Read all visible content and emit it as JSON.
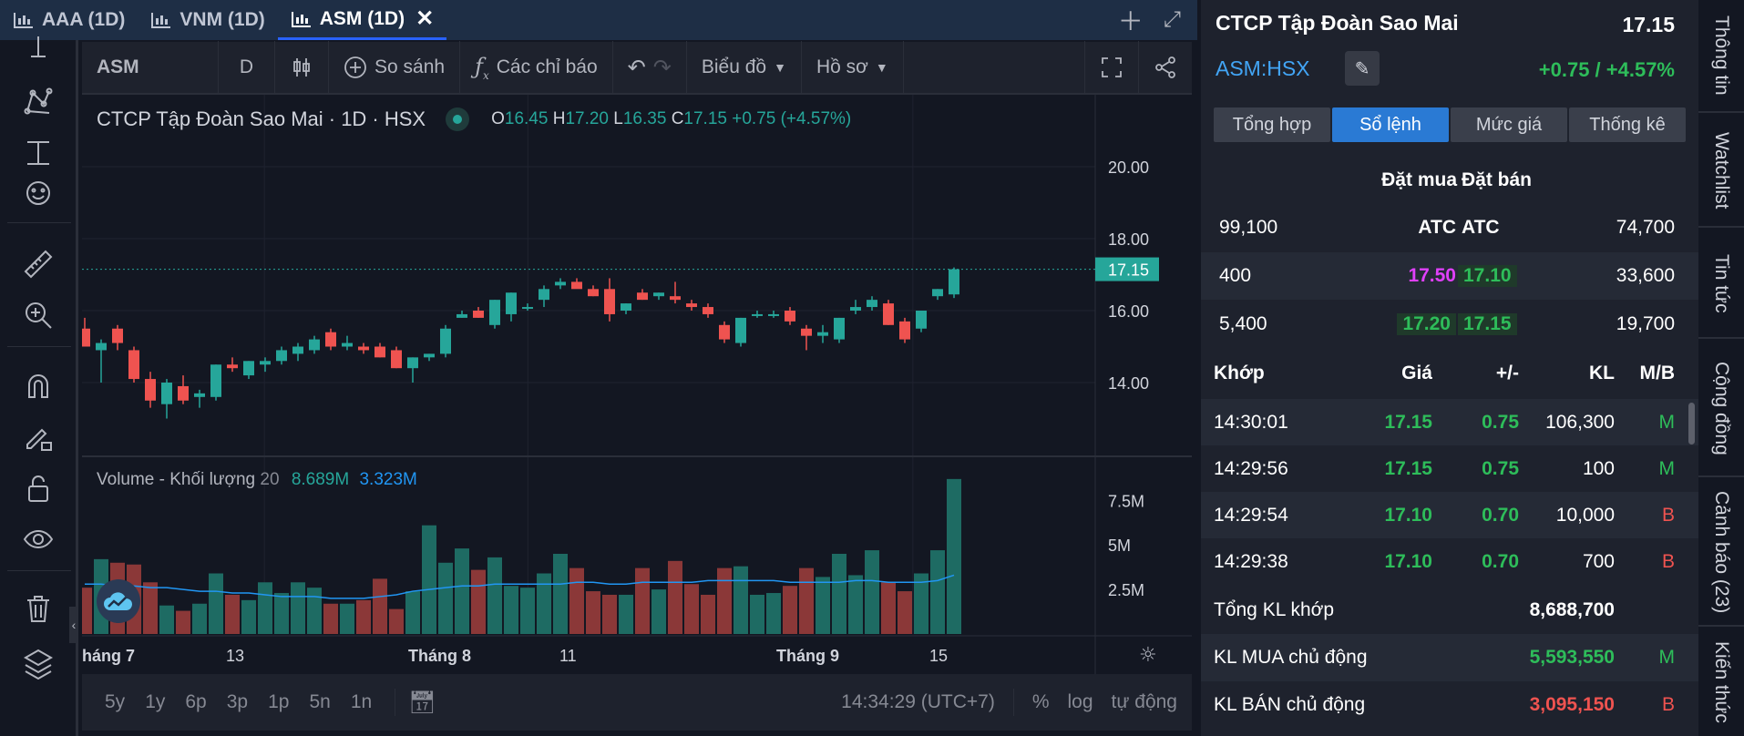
{
  "tabs": [
    {
      "label": "AAA (1D)",
      "active": false
    },
    {
      "label": "VNM (1D)",
      "active": false
    },
    {
      "label": "ASM (1D)",
      "active": true
    }
  ],
  "toolbar": {
    "symbol": "ASM",
    "interval": "D",
    "compare": "So sánh",
    "indicators": "Các chỉ báo",
    "chart_type": "Biểu đồ",
    "profile": "Hồ sơ"
  },
  "legend": {
    "title": "CTCP Tập Đoàn Sao Mai · 1D · HSX",
    "o_label": "O",
    "o": "16.45",
    "h_label": "H",
    "h": "17.20",
    "l_label": "L",
    "l": "16.35",
    "c_label": "C",
    "c": "17.15",
    "chg": "+0.75 (+4.57%)"
  },
  "volume_legend": {
    "label": "Volume - Khối lượng",
    "period": "20",
    "v1": "8.689M",
    "v2": "3.323M"
  },
  "bottom": {
    "ranges": [
      "5y",
      "1y",
      "6p",
      "3p",
      "1p",
      "5n",
      "1n"
    ],
    "time": "14:34:29 (UTC+7)",
    "pct": "%",
    "log": "log",
    "auto": "tự động"
  },
  "chart_data": {
    "type": "candlestick",
    "last_price": "17.15",
    "price_ticks": [
      "20.00",
      "18.00",
      "16.00",
      "14.00"
    ],
    "volume_ticks": [
      "7.5M",
      "5M",
      "2.5M"
    ],
    "x_labels": [
      "háng 7",
      "13",
      "Tháng 8",
      "11",
      "Tháng 9",
      "15"
    ],
    "ylim": [
      12.0,
      22.0
    ],
    "candles": [
      {
        "o": 15.5,
        "h": 15.8,
        "l": 15.0,
        "c": 15.0
      },
      {
        "o": 14.9,
        "h": 15.2,
        "l": 14.0,
        "c": 15.1
      },
      {
        "o": 15.5,
        "h": 15.6,
        "l": 14.9,
        "c": 15.1
      },
      {
        "o": 14.9,
        "h": 15.0,
        "l": 14.0,
        "c": 14.1
      },
      {
        "o": 14.1,
        "h": 14.3,
        "l": 13.3,
        "c": 13.5
      },
      {
        "o": 13.4,
        "h": 14.1,
        "l": 13.0,
        "c": 14.0
      },
      {
        "o": 13.9,
        "h": 14.2,
        "l": 13.4,
        "c": 13.5
      },
      {
        "o": 13.6,
        "h": 13.8,
        "l": 13.3,
        "c": 13.7
      },
      {
        "o": 13.6,
        "h": 14.5,
        "l": 13.5,
        "c": 14.5
      },
      {
        "o": 14.5,
        "h": 14.7,
        "l": 14.3,
        "c": 14.4
      },
      {
        "o": 14.2,
        "h": 14.6,
        "l": 14.1,
        "c": 14.6
      },
      {
        "o": 14.5,
        "h": 14.7,
        "l": 14.3,
        "c": 14.6
      },
      {
        "o": 14.6,
        "h": 15.0,
        "l": 14.5,
        "c": 14.9
      },
      {
        "o": 14.8,
        "h": 15.1,
        "l": 14.6,
        "c": 15.0
      },
      {
        "o": 14.9,
        "h": 15.3,
        "l": 14.8,
        "c": 15.2
      },
      {
        "o": 15.4,
        "h": 15.5,
        "l": 14.9,
        "c": 15.0
      },
      {
        "o": 15.0,
        "h": 15.3,
        "l": 14.9,
        "c": 15.1
      },
      {
        "o": 15.0,
        "h": 15.1,
        "l": 14.8,
        "c": 14.9
      },
      {
        "o": 15.0,
        "h": 15.1,
        "l": 14.7,
        "c": 14.7
      },
      {
        "o": 14.9,
        "h": 15.0,
        "l": 14.4,
        "c": 14.4
      },
      {
        "o": 14.4,
        "h": 14.7,
        "l": 14.0,
        "c": 14.7
      },
      {
        "o": 14.7,
        "h": 14.8,
        "l": 14.6,
        "c": 14.8
      },
      {
        "o": 14.8,
        "h": 15.6,
        "l": 14.7,
        "c": 15.5
      },
      {
        "o": 15.8,
        "h": 16.0,
        "l": 15.8,
        "c": 15.9
      },
      {
        "o": 16.0,
        "h": 16.1,
        "l": 15.8,
        "c": 15.8
      },
      {
        "o": 15.6,
        "h": 16.3,
        "l": 15.5,
        "c": 16.3
      },
      {
        "o": 15.9,
        "h": 16.5,
        "l": 15.7,
        "c": 16.5
      },
      {
        "o": 16.1,
        "h": 16.2,
        "l": 16.0,
        "c": 16.1
      },
      {
        "o": 16.3,
        "h": 16.7,
        "l": 16.1,
        "c": 16.6
      },
      {
        "o": 16.7,
        "h": 16.9,
        "l": 16.6,
        "c": 16.8
      },
      {
        "o": 16.8,
        "h": 16.9,
        "l": 16.7,
        "c": 16.6
      },
      {
        "o": 16.6,
        "h": 16.7,
        "l": 16.4,
        "c": 16.4
      },
      {
        "o": 16.6,
        "h": 16.9,
        "l": 15.7,
        "c": 15.9
      },
      {
        "o": 16.0,
        "h": 16.2,
        "l": 15.9,
        "c": 16.2
      },
      {
        "o": 16.5,
        "h": 16.6,
        "l": 16.3,
        "c": 16.3
      },
      {
        "o": 16.4,
        "h": 16.5,
        "l": 16.3,
        "c": 16.5
      },
      {
        "o": 16.4,
        "h": 16.8,
        "l": 16.2,
        "c": 16.3
      },
      {
        "o": 16.2,
        "h": 16.3,
        "l": 16.0,
        "c": 16.1
      },
      {
        "o": 16.1,
        "h": 16.2,
        "l": 15.8,
        "c": 15.9
      },
      {
        "o": 15.6,
        "h": 15.7,
        "l": 15.1,
        "c": 15.2
      },
      {
        "o": 15.1,
        "h": 15.8,
        "l": 15.0,
        "c": 15.8
      },
      {
        "o": 15.9,
        "h": 16.0,
        "l": 15.8,
        "c": 15.9
      },
      {
        "o": 15.9,
        "h": 16.0,
        "l": 15.8,
        "c": 15.9
      },
      {
        "o": 16.0,
        "h": 16.1,
        "l": 15.6,
        "c": 15.7
      },
      {
        "o": 15.5,
        "h": 15.6,
        "l": 14.9,
        "c": 15.3
      },
      {
        "o": 15.3,
        "h": 15.6,
        "l": 15.1,
        "c": 15.4
      },
      {
        "o": 15.2,
        "h": 15.8,
        "l": 15.1,
        "c": 15.8
      },
      {
        "o": 16.0,
        "h": 16.3,
        "l": 15.9,
        "c": 16.1
      },
      {
        "o": 16.1,
        "h": 16.4,
        "l": 16.0,
        "c": 16.3
      },
      {
        "o": 16.2,
        "h": 16.3,
        "l": 15.6,
        "c": 15.6
      },
      {
        "o": 15.7,
        "h": 15.8,
        "l": 15.1,
        "c": 15.2
      },
      {
        "o": 15.5,
        "h": 16.0,
        "l": 15.4,
        "c": 16.0
      },
      {
        "o": 16.4,
        "h": 16.6,
        "l": 16.3,
        "c": 16.6
      },
      {
        "o": 16.45,
        "h": 17.2,
        "l": 16.35,
        "c": 17.15
      }
    ],
    "volumes": [
      2.6,
      4.2,
      4.0,
      3.9,
      2.9,
      1.6,
      1.3,
      1.7,
      3.4,
      2.2,
      1.9,
      2.9,
      2.3,
      2.9,
      2.6,
      1.7,
      1.7,
      1.9,
      3.1,
      1.4,
      2.4,
      6.1,
      4.0,
      4.8,
      3.6,
      4.3,
      2.7,
      2.6,
      3.4,
      4.5,
      3.7,
      2.4,
      2.2,
      2.2,
      3.7,
      2.5,
      4.1,
      2.8,
      2.2,
      3.7,
      3.8,
      2.2,
      2.3,
      2.7,
      3.7,
      3.2,
      4.5,
      3.3,
      4.7,
      2.9,
      2.4,
      3.4,
      4.7,
      8.7
    ],
    "ma_volume": [
      2.8,
      2.8,
      2.7,
      2.7,
      2.6,
      2.6,
      2.5,
      2.4,
      2.4,
      2.3,
      2.3,
      2.2,
      2.1,
      2.1,
      2.1,
      2.0,
      2.0,
      2.0,
      2.1,
      2.2,
      2.4,
      2.5,
      2.6,
      2.7,
      2.7,
      2.8,
      2.8,
      2.8,
      2.8,
      2.8,
      2.9,
      2.9,
      2.8,
      2.8,
      2.9,
      2.9,
      2.9,
      2.9,
      3.0,
      3.0,
      3.0,
      3.0,
      3.0,
      2.9,
      2.9,
      2.9,
      2.9,
      3.0,
      3.0,
      2.9,
      2.9,
      2.9,
      3.0,
      3.3
    ],
    "vmax": 9.0
  },
  "panel": {
    "name": "CTCP Tập Đoàn Sao Mai",
    "price": "17.15",
    "symbol": "ASM:HSX",
    "change": "+0.75 / +4.57%",
    "subtabs": [
      "Tổng hợp",
      "Sổ lệnh",
      "Mức giá",
      "Thống kê"
    ],
    "bid_header": "Đặt mua",
    "ask_header": "Đặt bán",
    "orderbook": [
      {
        "bvol": "99,100",
        "bprice": "ATC",
        "aprice": "ATC",
        "avol": "74,700"
      },
      {
        "bvol": "400",
        "bprice": "17.50",
        "aprice": "17.10",
        "avol": "33,600"
      },
      {
        "bvol": "5,400",
        "bprice": "17.20",
        "aprice": "17.15",
        "avol": "19,700"
      }
    ],
    "match_headers": [
      "Khớp",
      "Giá",
      "+/-",
      "KL",
      "M/B"
    ],
    "matches": [
      {
        "t": "14:30:01",
        "p": "17.15",
        "d": "0.75",
        "v": "106,300",
        "s": "M"
      },
      {
        "t": "14:29:56",
        "p": "17.15",
        "d": "0.75",
        "v": "100",
        "s": "M"
      },
      {
        "t": "14:29:54",
        "p": "17.10",
        "d": "0.70",
        "v": "10,000",
        "s": "B"
      },
      {
        "t": "14:29:38",
        "p": "17.10",
        "d": "0.70",
        "v": "700",
        "s": "B"
      }
    ],
    "summary": [
      {
        "label": "Tổng KL khớp",
        "value": "8,688,700",
        "side": ""
      },
      {
        "label": "KL MUA chủ động",
        "value": "5,593,550",
        "side": "M"
      },
      {
        "label": "KL BÁN chủ động",
        "value": "3,095,150",
        "side": "B"
      }
    ]
  },
  "sidetabs": [
    "Thông tin",
    "Watchlist",
    "Tin tức",
    "Cộng đồng",
    "Cảnh báo (23)",
    "Kiến thức"
  ],
  "colors": {
    "up": "#26a69a",
    "down": "#ef5350",
    "ma": "#2196f3",
    "accent": "#2a7ad4"
  }
}
